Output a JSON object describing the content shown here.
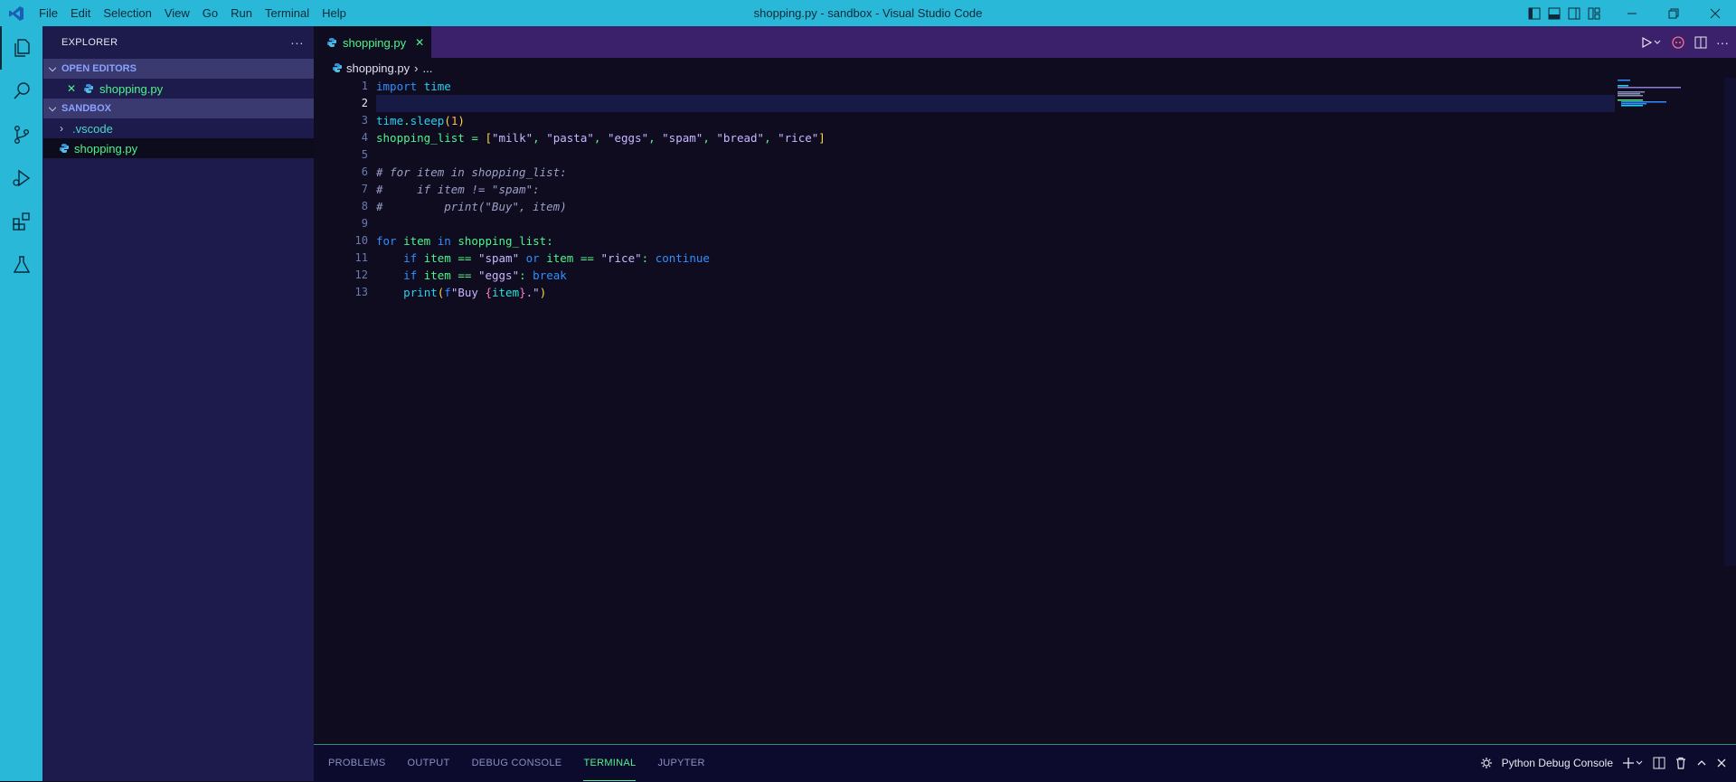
{
  "window": {
    "title": "shopping.py - sandbox - Visual Studio Code",
    "menu": [
      "File",
      "Edit",
      "Selection",
      "View",
      "Go",
      "Run",
      "Terminal",
      "Help"
    ]
  },
  "sidebar": {
    "title": "EXPLORER",
    "more": "···",
    "open_editors": {
      "label": "OPEN EDITORS",
      "items": [
        {
          "name": "shopping.py",
          "close": "✕"
        }
      ]
    },
    "workspace": {
      "label": "SANDBOX",
      "items": [
        {
          "name": ".vscode",
          "type": "folder"
        },
        {
          "name": "shopping.py",
          "type": "file"
        }
      ]
    }
  },
  "editor": {
    "tab": {
      "label": "shopping.py",
      "close": "✕"
    },
    "breadcrumb": {
      "file": "shopping.py",
      "sep": "›",
      "rest": "..."
    },
    "line_numbers": [
      "1",
      "2",
      "3",
      "4",
      "5",
      "6",
      "7",
      "8",
      "9",
      "10",
      "11",
      "12",
      "13"
    ],
    "current_line": 2,
    "lines": [
      "import time",
      "",
      "time.sleep(1)",
      "shopping_list = [\"milk\", \"pasta\", \"eggs\", \"spam\", \"bread\", \"rice\"]",
      "",
      "# for item in shopping_list:",
      "#     if item != \"spam\":",
      "#         print(\"Buy\", item)",
      "",
      "for item in shopping_list:",
      "    if item == \"spam\" or item == \"rice\": continue",
      "    if item == \"eggs\": break",
      "    print(f\"Buy {item}.\")"
    ]
  },
  "panel": {
    "tabs": [
      "PROBLEMS",
      "OUTPUT",
      "DEBUG CONSOLE",
      "TERMINAL",
      "JUPYTER"
    ],
    "active_tab": "TERMINAL",
    "terminal_name": "Python Debug Console"
  },
  "colors": {
    "accent": "#2ab8d8",
    "sidebar_bg": "#1c1b4c",
    "editor_bg": "#0f0c1f",
    "tabbar_bg": "#3b206b",
    "file_green": "#4cf58a"
  }
}
